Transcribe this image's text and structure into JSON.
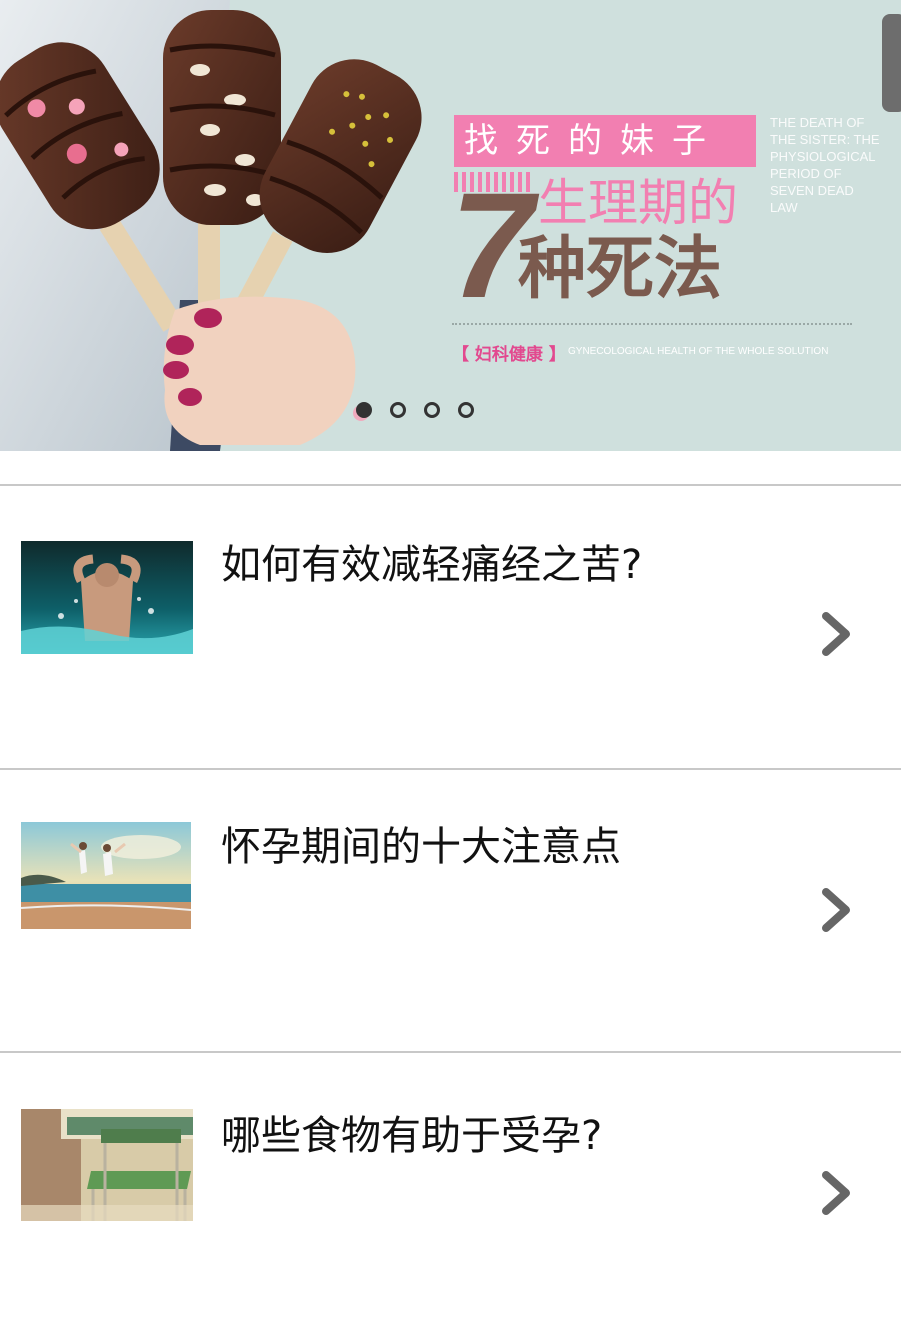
{
  "banner": {
    "headline_top": "找死的妹子",
    "headline_line1": "生理期的",
    "headline_number": "7",
    "headline_line2": "种死法",
    "side_english": "THE DEATH OF THE SISTER: THE PHYSIOLOGICAL PERIOD OF SEVEN DEAD LAW",
    "tag": "【 妇科健康 】",
    "tag_english": "GYNECOLOGICAL HEALTH OF THE WHOLE SOLUTION",
    "pager": {
      "total": 4,
      "active": 1
    }
  },
  "articles": [
    {
      "title": "如何有效减轻痛经之苦?",
      "thumbnail": "man-in-water-photo"
    },
    {
      "title": "怀孕期间的十大注意点",
      "thumbnail": "couple-jumping-beach-photo"
    },
    {
      "title": "哪些食物有助于受孕?",
      "thumbnail": "green-chair-classroom-photo"
    }
  ],
  "colors": {
    "banner_bg": "#cfe0dd",
    "pink_accent": "#f27fb1",
    "brown_text": "#7b5a4e",
    "chevron": "#666666",
    "divider": "#c8c8c8"
  }
}
